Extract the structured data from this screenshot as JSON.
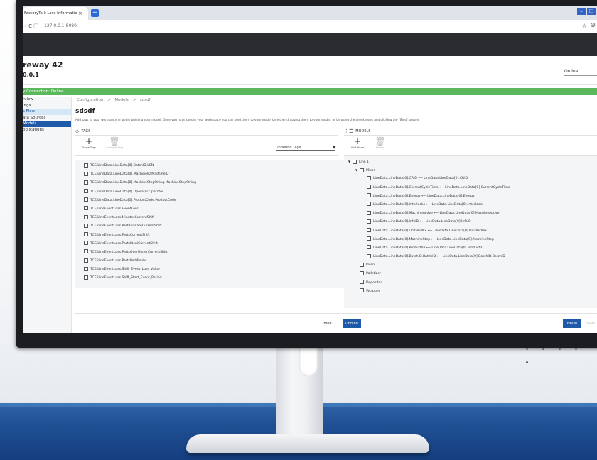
{
  "browser": {
    "tab_title": "FactoryTalk Loss Information Gat",
    "tab_close": "×",
    "new_tab": "+",
    "url": "127.0.0.1:8080",
    "nav": "→  C  ⓘ"
  },
  "app": {
    "title": "reway 42",
    "version": "0.0.1",
    "status_select": "Online",
    "connection": "y Connection: Online"
  },
  "sidebar": {
    "items": [
      "rview",
      "ings",
      "s Flow",
      "ata Sources",
      "Models",
      "pplications"
    ]
  },
  "breadcrumb": [
    "Configuration",
    ">",
    "Models",
    ">",
    "sdsdf"
  ],
  "page": {
    "title": "sdsdf",
    "hint": "Add tags to your workspace or begin building your model. Once you have tags in your workspace you can bind them to your model by either dragging them to your model, or by using the checkboxes and clicking the \"Bind\" button."
  },
  "tags_panel": {
    "header": "TAGS",
    "stage_tags": "Stage Tags",
    "unstage_tags": "Unstage Tags",
    "filter": "Unbound Tags",
    "items": [
      "TCE/LineData.LineData[0].BatchID.LEN",
      "TCE/LineData.LineData[0].MachineID.MachineID",
      "TCE/LineData.LineData[0].MachineStepString.MachineStepString",
      "TCE/LineData.LineData[0].Operator.Operator",
      "TCE/LineData.LineData[0].ProductCode.ProductCode",
      "TCE/LineEventLoss.EventLoss",
      "TCE/LineEventLoss.MinutesCurrentShift",
      "TCE/LineEventLoss.PartRunRateCurrentShift",
      "TCE/LineEventLoss.PartsCurrentShift",
      "TCE/LineEventLoss.PartsIdealCurrentShift",
      "TCE/LineEventLoss.PartsOverUnderCurrentShift",
      "TCE/LineEventLoss.PartsPerMinute",
      "TCE/LineEventLoss.Shift_Event_Loss_Value",
      "TCE/LineEventLoss.Shift_Start_Event_Period"
    ]
  },
  "models_panel": {
    "header": "MODELS",
    "add_node": "Add Node",
    "delete": "Delete",
    "tree": {
      "line": "Line 1",
      "mixer": "Mixer",
      "bindings": [
        "LineData.LineData[0].CRID  ⟵  LineData.LineData[0].CRID",
        "LineData.LineData[0].CurrentCycleTime  ⟵  LineData.LineData[0].CurrentCycleTime",
        "LineData.LineData[0].Energy  ⟵  LineData.LineData[0].Energy",
        "LineData.LineData[0].Interlocks  ⟵  LineData.LineData[0].Interlocks",
        "LineData.LineData[0].MachineActive  ⟵  LineData.LineData[0].MachineActive",
        "LineData.LineData[0].InfoID  ⟵  LineData.LineData[0].InfoID",
        "LineData.LineData[0].UnitPerMix  ⟵  LineData.LineData[0].UnitPerMix",
        "LineData.LineData[0].MachineStep  ⟵  LineData.LineData[0].MachineStep",
        "LineData.LineData[0].ProductID  ⟵  LineData.LineData[0].ProductID",
        "LineData.LineData[0].BatchID.BatchID  ⟵  LineData.LineData[0].BatchID.BatchID"
      ],
      "siblings": [
        "Oven",
        "Palletizer",
        "Depositor",
        "Wrapper"
      ]
    }
  },
  "footer": {
    "bind": "Bind",
    "unbind": "Unbind",
    "finish": "Finish",
    "save": "Save"
  },
  "colors": {
    "primary": "#1e5aa8",
    "connection_bar": "#5cb85c",
    "stage_blue": "#1f4f93"
  }
}
